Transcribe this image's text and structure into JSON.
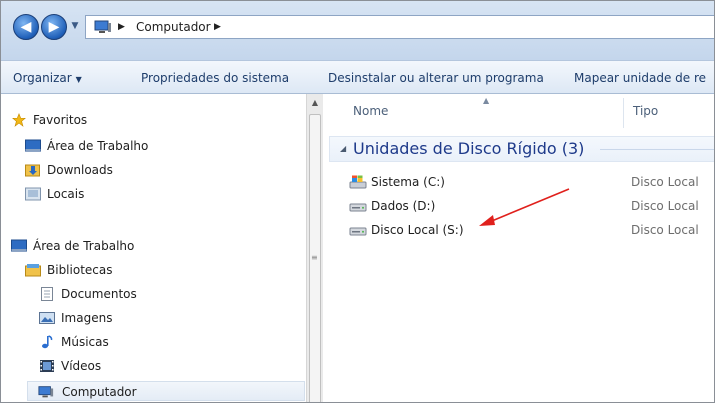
{
  "address": {
    "path_segment": "Computador"
  },
  "toolbar": {
    "organize": "Organizar",
    "system_properties": "Propriedades do sistema",
    "uninstall": "Desinstalar ou alterar um programa",
    "map_drive": "Mapear unidade de re"
  },
  "nav": {
    "favorites": "Favoritos",
    "desktop_fav": "Área de Trabalho",
    "downloads": "Downloads",
    "places": "Locais",
    "desktop": "Área de Trabalho",
    "libraries": "Bibliotecas",
    "documents": "Documentos",
    "images": "Imagens",
    "music": "Músicas",
    "videos": "Vídeos",
    "computer": "Computador"
  },
  "columns": {
    "name": "Nome",
    "type": "Tipo"
  },
  "group": {
    "title": "Unidades de Disco Rígido (3)"
  },
  "drives": [
    {
      "name": "Sistema (C:)",
      "type": "Disco Local"
    },
    {
      "name": "Dados (D:)",
      "type": "Disco Local"
    },
    {
      "name": "Disco Local (S:)",
      "type": "Disco Local"
    }
  ],
  "colors": {
    "accent": "#1e3a8a",
    "annotation_arrow": "#e0201c"
  }
}
